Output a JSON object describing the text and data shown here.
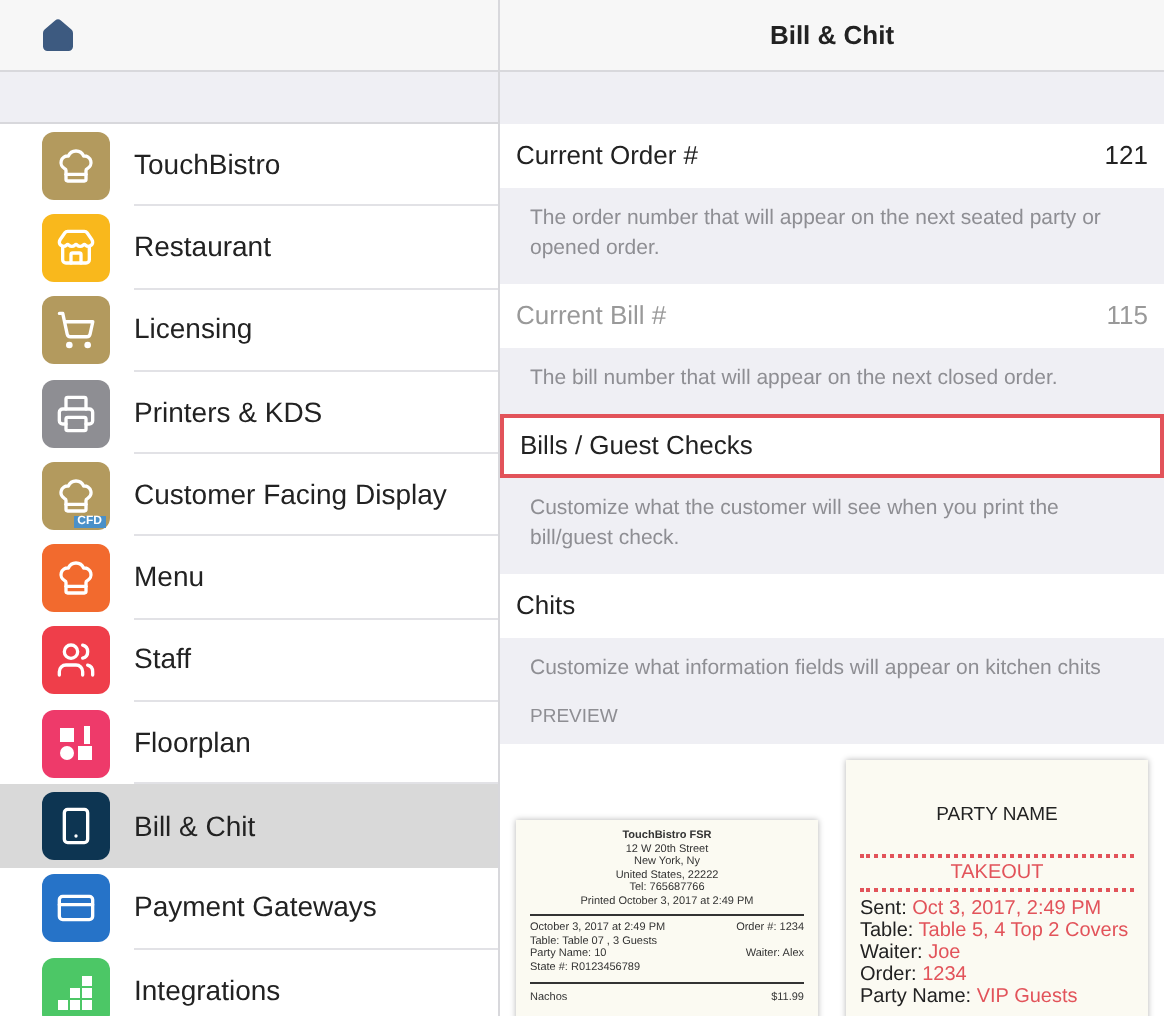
{
  "header": {
    "title": "Bill & Chit"
  },
  "sidebar": {
    "items": [
      {
        "label": "TouchBistro",
        "color": "#b39a5e",
        "selected": false
      },
      {
        "label": "Restaurant",
        "color": "#f9b81c",
        "selected": false
      },
      {
        "label": "Licensing",
        "color": "#b39a5e",
        "selected": false
      },
      {
        "label": "Printers & KDS",
        "color": "#8e8e93",
        "selected": false
      },
      {
        "label": "Customer Facing Display",
        "color": "#b39a5e",
        "badge": "CFD",
        "selected": false
      },
      {
        "label": "Menu",
        "color": "#f26a2e",
        "selected": false
      },
      {
        "label": "Staff",
        "color": "#ef3e4a",
        "selected": false
      },
      {
        "label": "Floorplan",
        "color": "#ee3a6a",
        "selected": false
      },
      {
        "label": "Bill & Chit",
        "color": "#0d3552",
        "selected": true
      },
      {
        "label": "Payment Gateways",
        "color": "#2673c8",
        "selected": false
      },
      {
        "label": "Integrations",
        "color": "#4cc766",
        "selected": false
      }
    ]
  },
  "settings": [
    {
      "label": "Current Order #",
      "value": "121",
      "disabled": false,
      "highlighted": false,
      "description": "The order number that will appear on the next seated party or opened order."
    },
    {
      "label": "Current Bill #",
      "value": "115",
      "disabled": true,
      "highlighted": false,
      "description": "The bill number that will appear on the next closed order."
    },
    {
      "label": "Bills / Guest Checks",
      "disabled": false,
      "highlighted": true,
      "description": "Customize what the customer will see when you print the bill/guest check."
    },
    {
      "label": "Chits",
      "disabled": false,
      "highlighted": false,
      "description": "Customize what information fields will appear on kitchen chits"
    }
  ],
  "preview": {
    "heading": "PREVIEW",
    "bill": {
      "header": [
        "TouchBistro FSR",
        "12 W 20th Street",
        "New York, Ny",
        "United States, 22222",
        "Tel: 765687766",
        "Printed October 3, 2017 at 2:49 PM"
      ],
      "info": [
        {
          "left": "October 3, 2017 at 2:49 PM",
          "right": "Order #: 1234"
        },
        {
          "left": "Table: Table 07 , 3 Guests"
        },
        {
          "left": "Party Name: 10",
          "right": "Waiter: Alex"
        },
        {
          "left": "State #: R01234567​89"
        }
      ],
      "items": [
        {
          "left": "Nachos",
          "right": "$11.99"
        }
      ]
    },
    "chit": {
      "title": "PARTY NAME",
      "order_type": "TAKEOUT",
      "fields": [
        {
          "label": "Sent:",
          "value": "Oct 3, 2017, 2:49 PM"
        },
        {
          "label": "Table:",
          "value": "Table 5, 4 Top 2 Covers"
        },
        {
          "label": "Waiter:",
          "value": "Joe"
        },
        {
          "label": "Order:",
          "value": "1234"
        },
        {
          "label": "Party Name:",
          "value": "VIP Guests"
        }
      ]
    }
  }
}
